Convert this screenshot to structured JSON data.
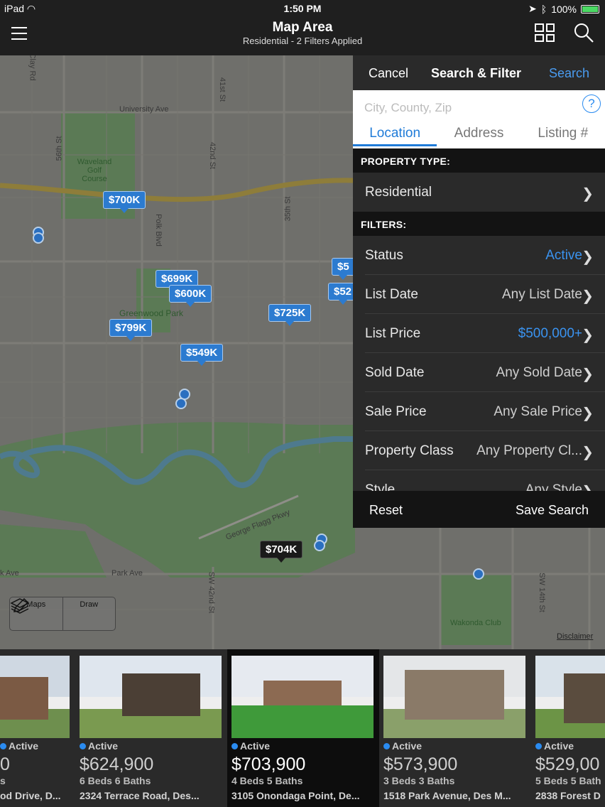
{
  "status_bar": {
    "device": "iPad",
    "time": "1:50 PM",
    "battery": "100%"
  },
  "header": {
    "title": "Map Area",
    "subtitle": "Residential - 2 Filters Applied"
  },
  "map": {
    "labels": {
      "university": "University Ave",
      "waveland": "Waveland Golf Course",
      "greenwood": "Greenwood Park",
      "polk": "Polk Blvd",
      "st56": "56th St",
      "st42": "42nd St",
      "st35": "35th St",
      "st41": "41st St",
      "clay": "Clay Rd",
      "george": "George Flagg Pkwy",
      "parkave": "Park Ave",
      "kave": "k Ave",
      "sw42": "SW 42nd St",
      "sw14": "SW 14th St",
      "wakonda": "Wakonda Club"
    },
    "pins": [
      "$700K",
      "$699K",
      "$600K",
      "$725K",
      "$799K",
      "$549K",
      "$5",
      "$52",
      "$704K",
      "$5"
    ],
    "tools": {
      "maps": "Maps",
      "draw": "Draw"
    },
    "disclaimer": "Disclaimer"
  },
  "filter_panel": {
    "cancel": "Cancel",
    "title": "Search & Filter",
    "search": "Search",
    "search_placeholder": "City, County, Zip",
    "help": "?",
    "tabs": [
      "Location",
      "Address",
      "Listing #"
    ],
    "property_type_header": "PROPERTY TYPE:",
    "property_type": "Residential",
    "filters_header": "FILTERS:",
    "filters": [
      {
        "label": "Status",
        "value": "Active",
        "highlight": true
      },
      {
        "label": "List Date",
        "value": "Any List Date",
        "highlight": false
      },
      {
        "label": "List Price",
        "value": "$500,000+",
        "highlight": true
      },
      {
        "label": "Sold Date",
        "value": "Any Sold Date",
        "highlight": false
      },
      {
        "label": "Sale Price",
        "value": "Any Sale Price",
        "highlight": false
      },
      {
        "label": "Property Class",
        "value": "Any Property Cl...",
        "highlight": false
      },
      {
        "label": "Style",
        "value": "Any Style",
        "highlight": false
      }
    ],
    "footer": {
      "reset": "Reset",
      "save": "Save Search"
    }
  },
  "listings": [
    {
      "status": "Active",
      "price": "0",
      "beds": "s",
      "address": "od Drive, D..."
    },
    {
      "status": "Active",
      "price": "$624,900",
      "beds": "6 Beds 6 Baths",
      "address": "2324 Terrace Road, Des..."
    },
    {
      "status": "Active",
      "price": "$703,900",
      "beds": "4 Beds 5 Baths",
      "address": "3105 Onondaga Point, De..."
    },
    {
      "status": "Active",
      "price": "$573,900",
      "beds": "3 Beds 3 Baths",
      "address": "1518 Park Avenue, Des M..."
    },
    {
      "status": "Active",
      "price": "$529,00",
      "beds": "5 Beds 5 Bath",
      "address": "2838 Forest D"
    }
  ],
  "colors": {
    "accent": "#2a8bf0",
    "pin": "#2c7bd0",
    "panel": "#2a2a2a"
  }
}
